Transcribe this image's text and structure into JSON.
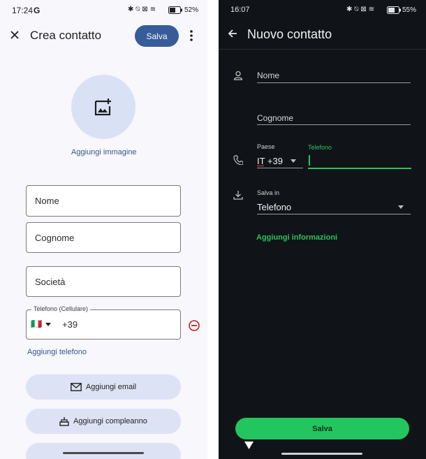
{
  "left": {
    "status_bar": {
      "time": "17:24",
      "g_logo": "G",
      "battery": "52%"
    },
    "app_bar": {
      "title": "Crea contatto",
      "save_label": "Salva"
    },
    "avatar": {
      "add_image_label": "Aggiungi immagine"
    },
    "fields": {
      "first_name_placeholder": "Nome",
      "last_name_placeholder": "Cognome",
      "company_placeholder": "Società"
    },
    "phone": {
      "legend": "Telefono (Cellulare)",
      "flag": "🇮🇹",
      "prefix": "+39"
    },
    "add_phone_label": "Aggiungi telefono",
    "buttons": {
      "add_email": "Aggiungi email",
      "add_birthday": "Aggiungi compleanno"
    },
    "colors": {
      "save": "#385c9a",
      "pill": "#dde3f5",
      "link": "#35598a",
      "remove": "#b3261e"
    }
  },
  "right": {
    "status_bar": {
      "time": "16:07",
      "battery": "55%"
    },
    "app_bar": {
      "title": "Nuovo contatto"
    },
    "fields": {
      "first_name_placeholder": "Nome",
      "last_name_placeholder": "Cognome",
      "country_label": "Paese",
      "country_value": "IT +39",
      "phone_label": "Telefono",
      "save_in_label": "Salva in",
      "save_in_value": "Telefono"
    },
    "add_info_label": "Aggiungi informazioni",
    "save_button_label": "Salva",
    "colors": {
      "accent": "#2ec15d",
      "button": "#23c55e",
      "background": "#101418"
    }
  }
}
